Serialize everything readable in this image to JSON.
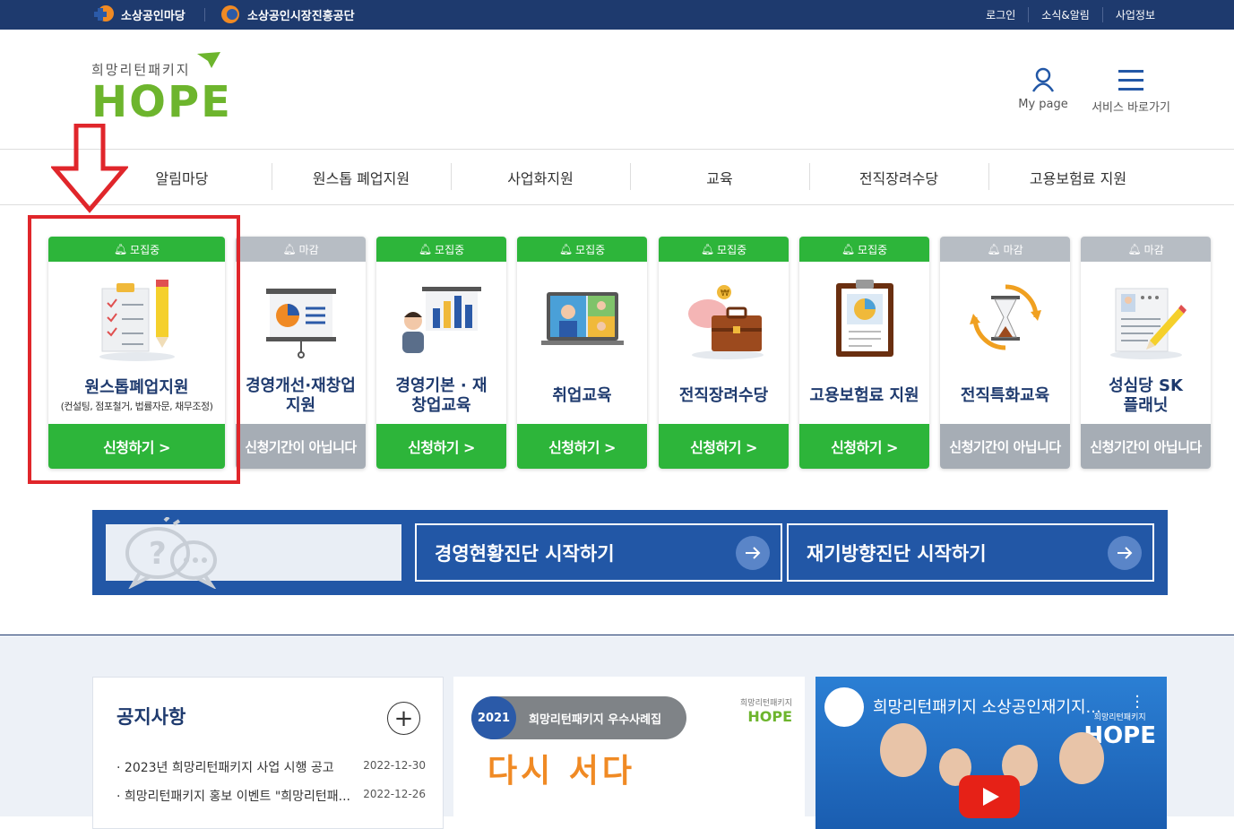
{
  "topbar": {
    "brand1": "소상공인마당",
    "brand2": "소상공인시장진흥공단",
    "links": [
      "로그인",
      "소식&알림",
      "사업정보"
    ]
  },
  "logo": {
    "subtitle": "희망리턴패키지",
    "wordmark": "HOPE"
  },
  "header": {
    "mypage_label": "My page",
    "service_label": "서비스 바로가기"
  },
  "nav": [
    "알림마당",
    "원스톱 폐업지원",
    "사업화지원",
    "교육",
    "전직장려수당",
    "고용보험료 지원"
  ],
  "cards": [
    {
      "status": "모집중",
      "title": "원스톱폐업지원",
      "subtitle": "(컨설팅, 점포철거, 법률자문, 채무조정)",
      "action": "신청하기 >",
      "open": true
    },
    {
      "status": "마감",
      "title": "경영개선·재창업 지원",
      "action": "신청기간이 아닙니다",
      "open": false
    },
    {
      "status": "모집중",
      "title": "경영기본 · 재창업교육",
      "action": "신청하기 >",
      "open": true
    },
    {
      "status": "모집중",
      "title": "취업교육",
      "action": "신청하기 >",
      "open": true
    },
    {
      "status": "모집중",
      "title": "전직장려수당",
      "action": "신청하기 >",
      "open": true
    },
    {
      "status": "모집중",
      "title": "고용보험료 지원",
      "action": "신청하기 >",
      "open": true
    },
    {
      "status": "마감",
      "title": "전직특화교육",
      "action": "신청기간이 아닙니다",
      "open": false
    },
    {
      "status": "마감",
      "title": "성심당 SK플래닛",
      "action": "신청기간이 아닙니다",
      "open": false
    }
  ],
  "diagnosis": {
    "button1": "경영현황진단 시작하기",
    "button2": "재기방향진단 시작하기"
  },
  "notice": {
    "title": "공지사항",
    "items": [
      {
        "title": "2023년 희망리턴패키지 사업 시행 공고",
        "date": "2022-12-30"
      },
      {
        "title": "희망리턴패키지 홍보 이벤트 \"희망리턴패...",
        "date": "2022-12-26"
      }
    ]
  },
  "promo": {
    "year": "2021",
    "pill_text": "희망리턴패키지 우수사례집",
    "headline": "다시 서다",
    "mini_sub": "희망리턴패키지",
    "mini_logo": "HOPE"
  },
  "video": {
    "title": "희망리턴패키지 소상공인재기지...",
    "badge_sub": "희망리턴패키지",
    "badge": "HOPE"
  },
  "colors": {
    "navy": "#1e3a6e",
    "green": "#2db53a",
    "gray": "#a6adb5",
    "banner_blue": "#2257a6",
    "highlight_red": "#e0262b"
  }
}
